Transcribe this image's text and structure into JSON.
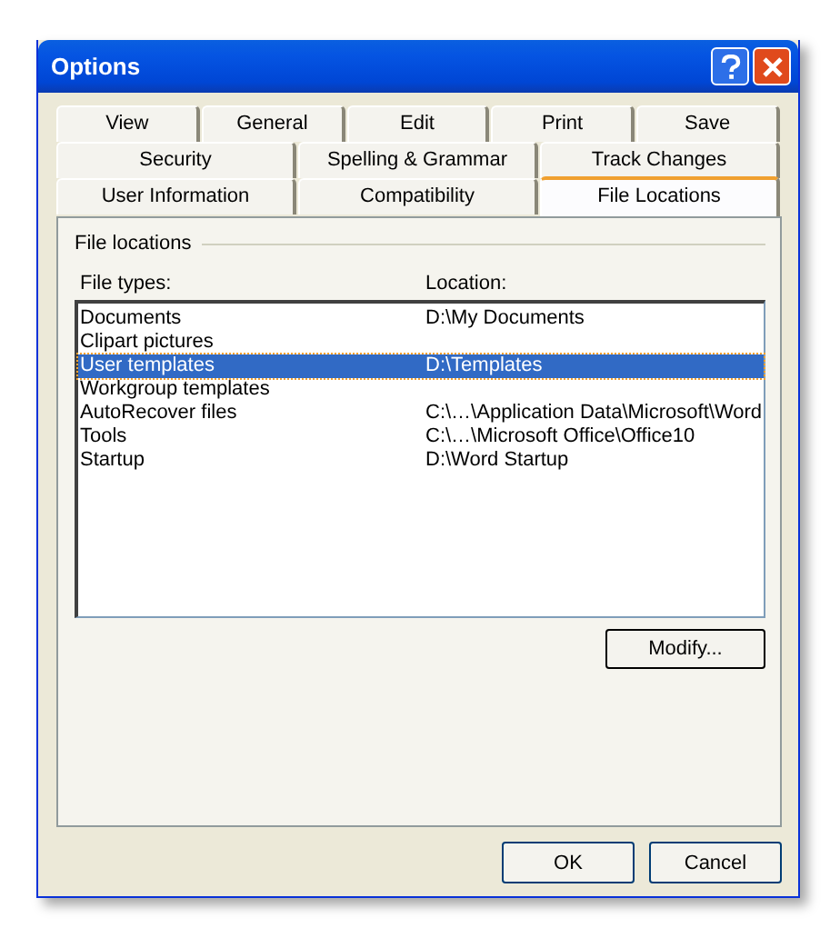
{
  "window": {
    "title": "Options"
  },
  "tab_rows": [
    [
      {
        "label": "View",
        "selected": false
      },
      {
        "label": "General",
        "selected": false
      },
      {
        "label": "Edit",
        "selected": false
      },
      {
        "label": "Print",
        "selected": false
      },
      {
        "label": "Save",
        "selected": false
      }
    ],
    [
      {
        "label": "Security",
        "selected": false
      },
      {
        "label": "Spelling & Grammar",
        "selected": false
      },
      {
        "label": "Track Changes",
        "selected": false
      }
    ],
    [
      {
        "label": "User Information",
        "selected": false
      },
      {
        "label": "Compatibility",
        "selected": false
      },
      {
        "label": "File Locations",
        "selected": true
      }
    ]
  ],
  "group_title": "File locations",
  "columns": [
    "File types:",
    "Location:"
  ],
  "rows": [
    {
      "type": "Documents",
      "location": "D:\\My Documents",
      "selected": false
    },
    {
      "type": "Clipart pictures",
      "location": "",
      "selected": false
    },
    {
      "type": "User templates",
      "location": "D:\\Templates",
      "selected": true
    },
    {
      "type": "Workgroup templates",
      "location": "",
      "selected": false
    },
    {
      "type": "AutoRecover files",
      "location": "C:\\…\\Application Data\\Microsoft\\Word",
      "selected": false
    },
    {
      "type": "Tools",
      "location": "C:\\…\\Microsoft Office\\Office10",
      "selected": false
    },
    {
      "type": "Startup",
      "location": "D:\\Word Startup",
      "selected": false
    }
  ],
  "modify_button": "Modify...",
  "buttons": [
    "OK",
    "Cancel"
  ]
}
